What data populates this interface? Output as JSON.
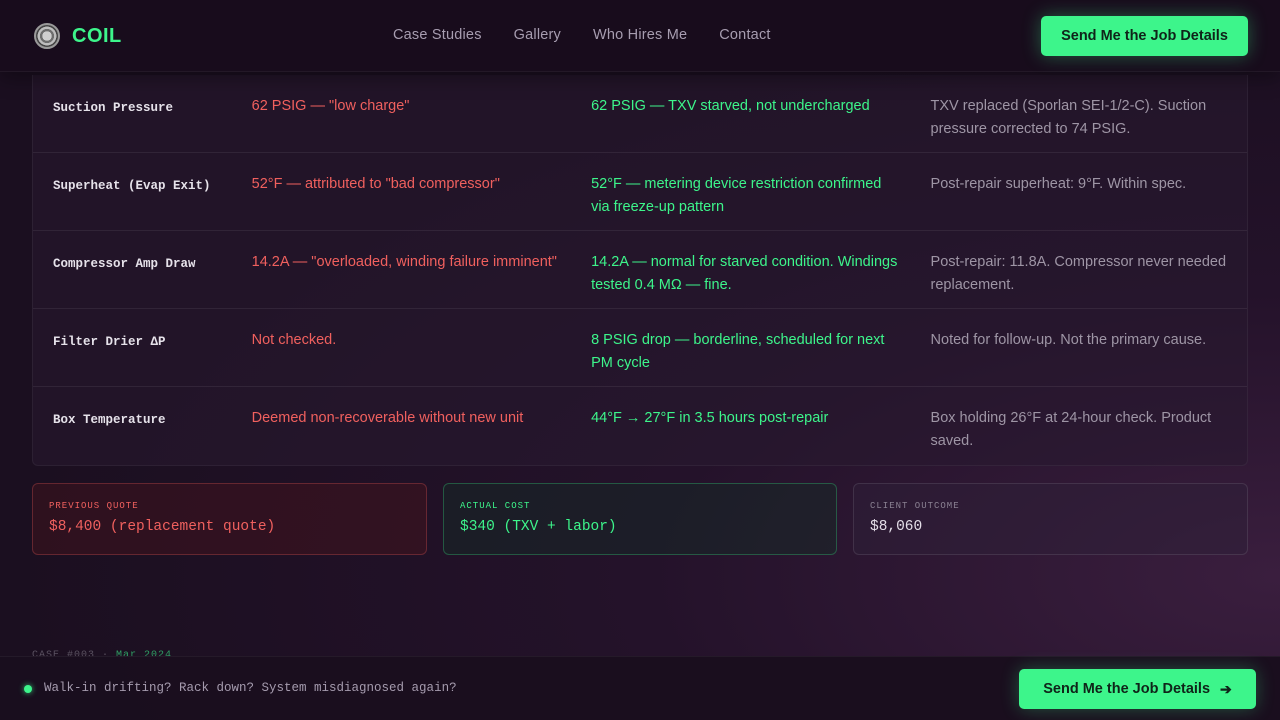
{
  "brand": {
    "name": "COIL",
    "logo_icon": "coil-badge-icon"
  },
  "nav": [
    "Case Studies",
    "Gallery",
    "Who Hires Me",
    "Contact"
  ],
  "header_cta": "Send Me the Job Details",
  "colors": {
    "accent": "#3df58b",
    "danger": "#f0605e",
    "muted": "#9e95a5",
    "background": "#1c1021"
  },
  "table": {
    "rows": [
      {
        "metric": "Suction Pressure",
        "previous": "62 PSIG — \"low charge\"",
        "found": "62 PSIG — TXV starved, not undercharged",
        "result": "TXV replaced (Sporlan SEI-1/2-C). Suction pressure corrected to 74 PSIG."
      },
      {
        "metric": "Superheat (Evap Exit)",
        "previous": "52°F — attributed to \"bad compressor\"",
        "found": "52°F — metering device restriction confirmed via freeze-up pattern",
        "result": "Post-repair superheat: 9°F. Within spec."
      },
      {
        "metric": "Compressor Amp Draw",
        "previous": "14.2A — \"overloaded, winding failure imminent\"",
        "found": "14.2A — normal for starved condition. Windings tested 0.4 MΩ — fine.",
        "result": "Post-repair: 11.8A. Compressor never needed replacement."
      },
      {
        "metric": "Filter Drier ΔP",
        "previous": "Not checked.",
        "found": "8 PSIG drop — borderline, scheduled for next PM cycle",
        "result": "Noted for follow-up. Not the primary cause."
      },
      {
        "metric": "Box Temperature",
        "previous": "Deemed non-recoverable without new unit",
        "found": "44°F → 27°F in 3.5 hours post-repair",
        "result": "Box holding 26°F at 24-hour check. Product saved."
      }
    ]
  },
  "cards": {
    "previous_quote": {
      "label": "Previous Quote",
      "value": "$8,400 (replacement quote)"
    },
    "actual_cost": {
      "label": "Actual Cost",
      "value": "$340 (TXV + labor)"
    },
    "client_outcome": {
      "label": "Client Outcome",
      "value": "$8,060"
    }
  },
  "next_case_peek": {
    "prefix": "CASE #003 · ",
    "date": "Mar 2024"
  },
  "bottom_bar": {
    "message": "Walk-in drifting? Rack down? System misdiagnosed again?",
    "cta": "Send Me the Job Details",
    "cta_icon": "arrow-right-icon"
  }
}
